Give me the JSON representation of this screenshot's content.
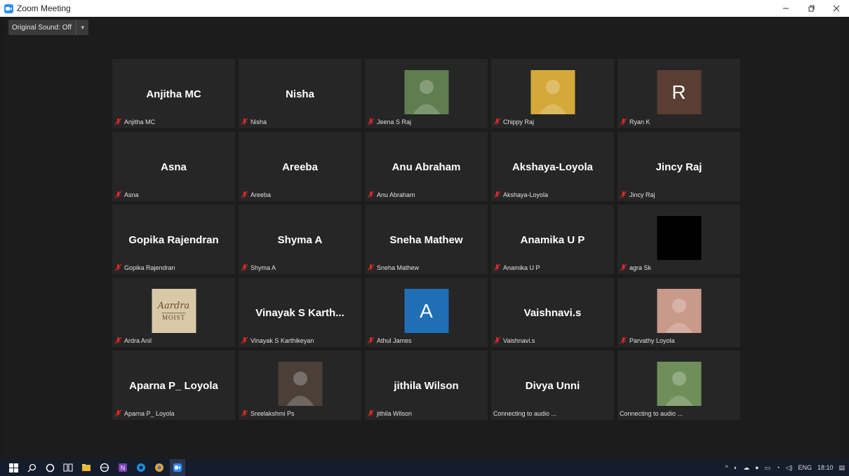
{
  "window": {
    "title": "Zoom Meeting"
  },
  "controls": {
    "original_sound": "Original Sound: Off"
  },
  "participants": [
    {
      "display": "Anjitha MC",
      "label": "Anjitha MC",
      "avatar": "none"
    },
    {
      "display": "Nisha",
      "label": "Nisha",
      "avatar": "none"
    },
    {
      "display": "",
      "label": "Jeena S Raj",
      "avatar": "photo",
      "avatar_color": "#5f7d4e"
    },
    {
      "display": "",
      "label": "Chippy Raj",
      "avatar": "photo",
      "avatar_color": "#d4a93a"
    },
    {
      "display": "",
      "label": "Ryan K",
      "avatar": "initial",
      "initial": "R",
      "avatar_color": "#5a3d33"
    },
    {
      "display": "Asna",
      "label": "Asna",
      "avatar": "none"
    },
    {
      "display": "Areeba",
      "label": "Areeba",
      "avatar": "none"
    },
    {
      "display": "Anu Abraham",
      "label": "Anu Abraham",
      "avatar": "none"
    },
    {
      "display": "Akshaya-Loyola",
      "label": "Akshaya-Loyola",
      "avatar": "none"
    },
    {
      "display": "Jincy Raj",
      "label": "Jincy Raj",
      "avatar": "none"
    },
    {
      "display": "Gopika Rajendran",
      "label": "Gopika Rajendran",
      "avatar": "none"
    },
    {
      "display": "Shyma A",
      "label": "Shyma A",
      "avatar": "none"
    },
    {
      "display": "Sneha Mathew",
      "label": "Sneha Mathew",
      "avatar": "none"
    },
    {
      "display": "Anamika U P",
      "label": "Anamika U P",
      "avatar": "none"
    },
    {
      "display": "",
      "label": "agra Sk",
      "avatar": "blank",
      "avatar_color": "#000000"
    },
    {
      "display": "",
      "label": "Ardra Anil",
      "avatar": "logo",
      "avatar_color": "#d9c9a8",
      "logo_line1": "Aardra",
      "logo_line2": "MOIST"
    },
    {
      "display": "Vinayak S Karth...",
      "label": "Vinayak S Karthikeyan",
      "avatar": "none"
    },
    {
      "display": "",
      "label": "Athul James",
      "avatar": "initial",
      "initial": "A",
      "avatar_color": "#1f6fb5"
    },
    {
      "display": "Vaishnavi.s",
      "label": "Vaishnavi.s",
      "avatar": "none"
    },
    {
      "display": "",
      "label": "Parvathy Loyola",
      "avatar": "photo",
      "avatar_color": "#c99a8a"
    },
    {
      "display": "Aparna P_ Loyola",
      "label": "Aparna P_ Loyola",
      "avatar": "none"
    },
    {
      "display": "",
      "label": "Sreelakshmi Ps",
      "avatar": "photo",
      "avatar_color": "#4a4038"
    },
    {
      "display": "jithila Wilson",
      "label": "jithila Wilson",
      "avatar": "none"
    },
    {
      "display": "Divya Unni",
      "label": "Connecting to audio ...",
      "avatar": "none",
      "connecting": true
    },
    {
      "display": "",
      "label": "Connecting to audio ...",
      "avatar": "photo",
      "avatar_color": "#6f8f5a",
      "connecting": true
    }
  ],
  "taskbar": {
    "language": "ENG",
    "time": "18:10"
  },
  "colors": {
    "mute_red": "#e02828",
    "zoom_blue": "#2d8cff"
  }
}
